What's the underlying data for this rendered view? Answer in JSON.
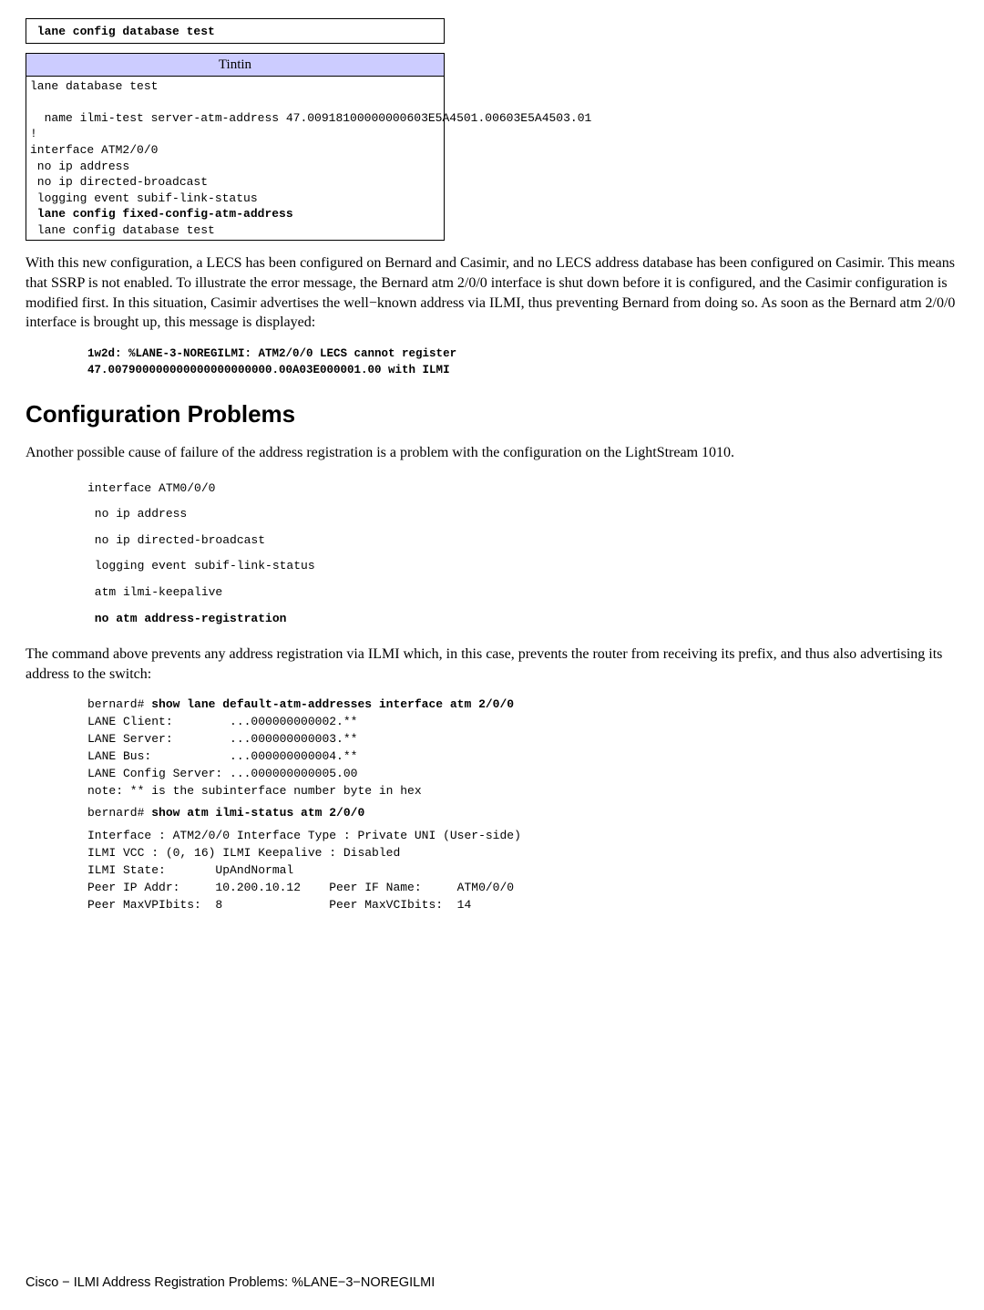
{
  "topbox": {
    "line": " lane config database test"
  },
  "tintin": {
    "header": "Tintin",
    "content_plain": "lane database test\n\n  name ilmi-test server-atm-address 47.00918100000000603E5A4501.00603E5A4503.01\n!\ninterface ATM2/0/0\n no ip address\n no ip directed-broadcast\n logging event subif-link-status",
    "bold_line": " lane config fixed-config-atm-address",
    "last_line": " lane config database test"
  },
  "para1": "With this new configuration, a LECS has been configured on Bernard and Casimir, and no LECS address database has been configured on Casimir. This means that SSRP is not enabled. To illustrate the error message, the Bernard atm 2/0/0 interface is shut down before it is configured, and the Casimir configuration is modified first. In this situation, Casimir advertises the well−known address via ILMI, thus preventing Bernard from doing so. As soon as the Bernard atm 2/0/0 interface is brought up, this message is displayed:",
  "code1_l1": "1w2d: %LANE-3-NOREGILMI: ATM2/0/0 LECS cannot register",
  "code1_l2": "47.007900000000000000000000.00A03E000001.00 with ILMI",
  "h2": "Configuration Problems",
  "para2": "Another possible cause of failure of the address registration is a problem with the configuration on the LightStream 1010.",
  "code2": {
    "l1": "interface ATM0/0/0",
    "l2": " no ip address",
    "l3": " no ip directed-broadcast",
    "l4": " logging event subif-link-status",
    "l5": " atm ilmi-keepalive",
    "l6": " no atm address-registration"
  },
  "para3": "The command above prevents any address registration via ILMI which, in this case, prevents the router from receiving its prefix, and thus also advertising its address to the switch:",
  "code3": {
    "l01a": "bernard# ",
    "l01b": "show lane default-atm-addresses interface atm 2/0/0",
    "l02": "LANE Client:        ...000000000002.**",
    "l03": "LANE Server:        ...000000000003.**",
    "l04": "LANE Bus:           ...000000000004.**",
    "l05": "LANE Config Server: ...000000000005.00",
    "l06": "note: ** is the subinterface number byte in hex",
    "l07a": "bernard# ",
    "l07b": "show atm ilmi-status atm 2/0/0",
    "l08": "Interface : ATM2/0/0 Interface Type : Private UNI (User-side)",
    "l09": "ILMI VCC : (0, 16) ILMI Keepalive : Disabled",
    "l10": "ILMI State:       UpAndNormal",
    "l11": "Peer IP Addr:     10.200.10.12    Peer IF Name:     ATM0/0/0",
    "l12": "Peer MaxVPIbits:  8               Peer MaxVCIbits:  14"
  },
  "footer": "Cisco − ILMI Address Registration Problems: %LANE−3−NOREGILMI"
}
